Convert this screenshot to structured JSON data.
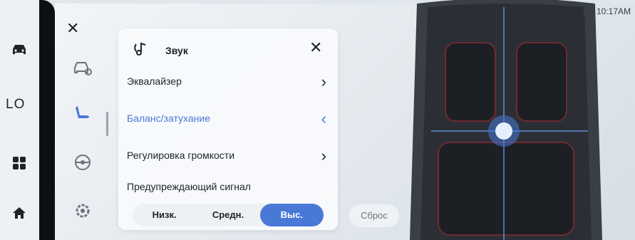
{
  "left_rail": {
    "items": [
      {
        "icon": "car-icon"
      },
      {
        "text": "LO"
      },
      {
        "icon": "apps-grid-icon"
      },
      {
        "icon": "home-icon"
      }
    ]
  },
  "settings_menu": {
    "items": [
      {
        "icon": "car-settings-icon"
      },
      {
        "icon": "seat-icon"
      },
      {
        "icon": "steering-wheel-icon"
      },
      {
        "icon": "gear-icon"
      }
    ]
  },
  "panel": {
    "title": "Звук",
    "rows": [
      {
        "label": "Эквалайзер",
        "chevron": "›"
      },
      {
        "label": "Баланс/затухание",
        "chevron": "‹"
      },
      {
        "label": "Регулировка громкости",
        "chevron": "›"
      },
      {
        "label": "Предупреждающий сигнал",
        "chevron": ""
      }
    ],
    "level_options": [
      "Низк.",
      "Средн.",
      "Выс."
    ],
    "selected_level": "Выс."
  },
  "reset_label": "Сброс",
  "status": {
    "time": "10:17AM"
  },
  "colors": {
    "accent": "#4a78d6",
    "rail_bg": "#0e0f11"
  }
}
